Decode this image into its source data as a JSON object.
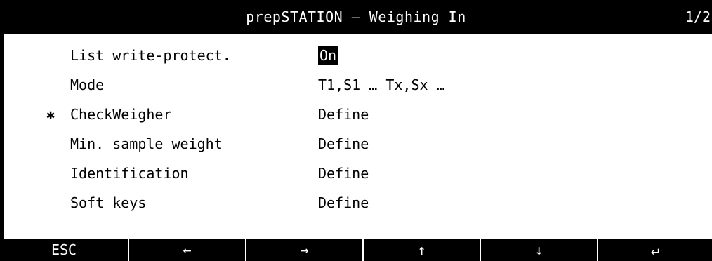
{
  "header": {
    "title": "prepSTATION – Weighing In",
    "page_indicator": "1/2"
  },
  "rows": [
    {
      "marker": "",
      "label": "List write-protect.",
      "value": "On",
      "selected": true
    },
    {
      "marker": "",
      "label": "Mode",
      "value": "T1,S1  …  Tx,Sx  …",
      "selected": false
    },
    {
      "marker": "✱",
      "label": "CheckWeigher",
      "value": "Define",
      "selected": false
    },
    {
      "marker": "",
      "label": "Min. sample weight",
      "value": "Define",
      "selected": false
    },
    {
      "marker": "",
      "label": "Identification",
      "value": "Define",
      "selected": false
    },
    {
      "marker": "",
      "label": "Soft keys",
      "value": "Define",
      "selected": false
    }
  ],
  "softkeys": [
    {
      "label": "ESC",
      "icon": "esc"
    },
    {
      "label": "←",
      "icon": "arrow-left-icon"
    },
    {
      "label": "→",
      "icon": "arrow-right-icon"
    },
    {
      "label": "↑",
      "icon": "arrow-up-icon"
    },
    {
      "label": "↓",
      "icon": "arrow-down-icon"
    },
    {
      "label": "↵",
      "icon": "enter-icon"
    }
  ],
  "colors": {
    "background": "#ffffff",
    "foreground": "#000000",
    "inverse": "#ffffff"
  }
}
